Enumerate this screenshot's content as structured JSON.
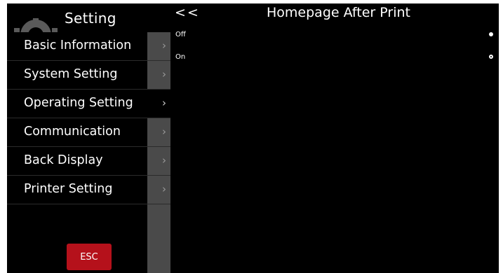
{
  "sidebar": {
    "title": "Setting",
    "items": [
      {
        "label": "Basic Information",
        "chevron": "›"
      },
      {
        "label": "System Setting",
        "chevron": "›"
      },
      {
        "label": "Operating Setting",
        "chevron": "›"
      },
      {
        "label": "Communication",
        "chevron": "›"
      },
      {
        "label": "Back Display",
        "chevron": "›"
      },
      {
        "label": "Printer Setting",
        "chevron": "›"
      }
    ],
    "active_item": "Operating Setting",
    "esc_label": "ESC"
  },
  "main": {
    "back_label": "<<",
    "title": "Homepage After Print",
    "options": [
      {
        "label": "Off",
        "selected": true
      },
      {
        "label": "On",
        "selected": false
      }
    ]
  },
  "colors": {
    "background": "#000000",
    "esc_button": "#b5111b",
    "sidebar_strip": "#4a4a4a",
    "text": "#ffffff"
  },
  "icons": {
    "header_decoration": "gear-icon",
    "menu_chevron": "chevron-right-icon",
    "option_selector": "radio-icon"
  }
}
